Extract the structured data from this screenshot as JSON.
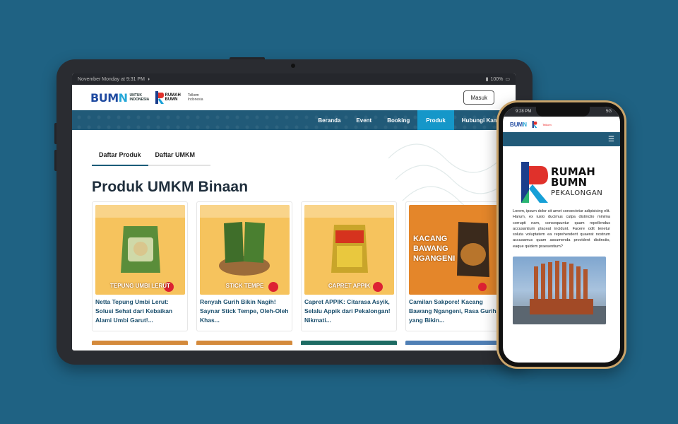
{
  "tablet": {
    "statusbar": {
      "time": "November Monday at 9:31 PM",
      "battery": "100%"
    },
    "header": {
      "logo_bumn_word_a": "BUM",
      "logo_bumn_word_b": "N",
      "logo_bumn_sub": "UNTUK INDONESIA",
      "logo_rb_line1": "RUMAH",
      "logo_rb_line2": "BUMN",
      "logo_tel_line1": "Telkom",
      "logo_tel_line2": "Indonesia",
      "login_label": "Masuk"
    },
    "nav": {
      "items": [
        {
          "label": "Beranda"
        },
        {
          "label": "Event"
        },
        {
          "label": "Booking"
        },
        {
          "label": "Produk"
        },
        {
          "label": "Hubungi Kami"
        }
      ],
      "active": "Produk"
    },
    "tabs": [
      {
        "label": "Daftar Produk"
      },
      {
        "label": "Daftar UMKM"
      }
    ],
    "page_title": "Produk UMKM Binaan",
    "cards": [
      {
        "banner": "TEPUNG UMBI LERUT",
        "caption": "Netta Tepung Umbi Lerut: Solusi Sehat dari Kebaikan Alami Umbi Garut!...",
        "accent": "#f7c45c"
      },
      {
        "banner": "STICK TEMPE",
        "caption": "Renyah Gurih Bikin Nagih! Saynar Stick Tempe, Oleh-Oleh Khas...",
        "accent": "#f7c45c"
      },
      {
        "banner": "CAPRET APPIK",
        "caption": "Capret APPIK: Citarasa Asyik, Selalu Appik dari Pekalongan! Nikmati...",
        "accent": "#f7c45c"
      },
      {
        "banner": "KACANG BAWANG NGANGENI",
        "caption": "Camilan Sakpore! Kacang Bawang Ngangeni, Rasa Gurih yang Bikin...",
        "accent": "#e4862a"
      }
    ]
  },
  "phone": {
    "statusbar": {
      "time": "9:28 PM",
      "signal": "5G"
    },
    "logo_line1": "RUMAH",
    "logo_line2": "BUMN",
    "logo_line3": "PEKALONGAN",
    "body_text": "Lorem, ipsum dolor sit amet consectetur adipisicing elit. Harum, ex iusto ducimus culpa distinctio minima corrupti nam, consequuntur quam repellendus accusantium placeat incidunt. Facere odit tenetur soluta voluptatem ea reprehenderit quaerat nostrum accusamus quam assumenda provident distinctio, eaque quidem praesentium?"
  },
  "colors": {
    "background": "#1f6283",
    "navbar": "#215a78",
    "nav_active": "#1597c9",
    "title": "#1f2e3c",
    "caption": "#1b4f6d"
  }
}
